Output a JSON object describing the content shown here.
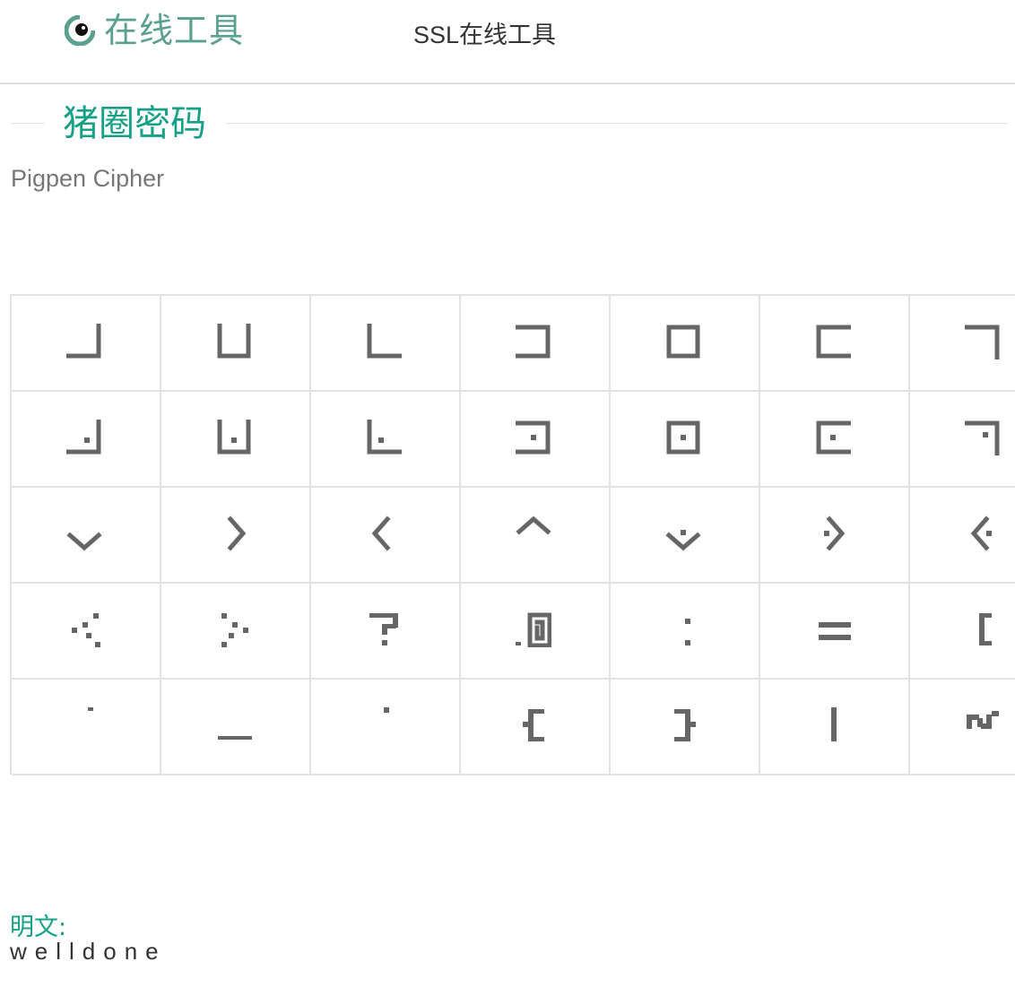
{
  "header": {
    "logo_text": "在线工具",
    "logo_icon": "eye-logo-icon",
    "nav_link": "SSL在线工具"
  },
  "page": {
    "title": "猪圈密码",
    "subtitle": "Pigpen Cipher"
  },
  "cipher_grid": {
    "rows": 5,
    "cols": 7,
    "glyphs": [
      [
        "frame-top-left",
        "frame-top",
        "frame-top-right",
        "frame-left",
        "frame-box",
        "frame-right",
        "frame-bottom-left"
      ],
      [
        "frame-top-left-dot",
        "frame-top-dot",
        "frame-top-right-dot",
        "frame-left-dot",
        "frame-box-dot",
        "frame-right-dot",
        "frame-bottom-left-dot"
      ],
      [
        "v-down",
        "v-right",
        "v-left",
        "v-up",
        "v-down-dot",
        "v-right-dot",
        "v-left-dot"
      ],
      [
        "dots-left",
        "dots-right",
        "question-mark",
        "square-spiral",
        "colon",
        "double-line",
        "bracket-left"
      ],
      [
        "small-dot",
        "underscore",
        "single-dot",
        "brace-left",
        "brace-right",
        "vertical-bar",
        "tilde"
      ]
    ]
  },
  "result": {
    "label": "明文:",
    "value": "welldone"
  },
  "colors": {
    "accent": "#16a085",
    "logo": "#5aa08f",
    "glyph": "#666666",
    "border": "#e2e2e2"
  }
}
